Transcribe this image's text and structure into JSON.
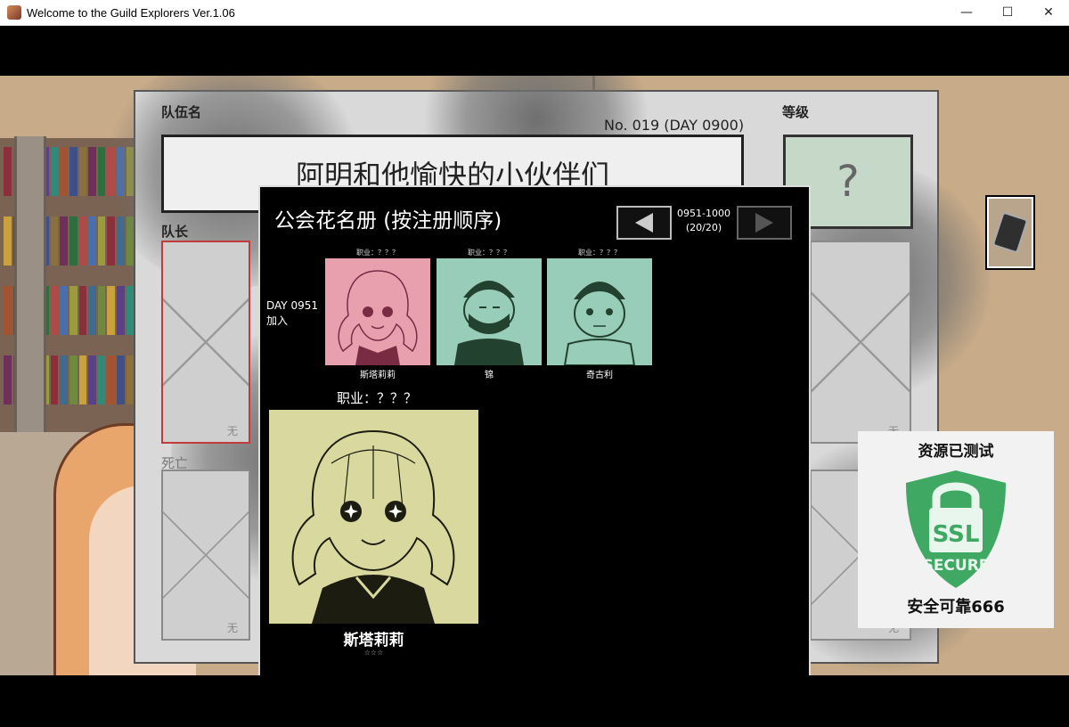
{
  "window": {
    "title": "Welcome to the Guild Explorers Ver.1.06",
    "minimize_glyph": "—",
    "maximize_glyph": "☐",
    "close_glyph": "✕"
  },
  "party_sheet": {
    "team_label": "队伍名",
    "party_name": "阿明和他愉快的小伙伴们",
    "number_text": "No. 019 (DAY 0900)",
    "rank_label": "等级",
    "rank_value": "?",
    "leader_label": "队长",
    "dead_label": "死亡",
    "empty_slot_text": "无"
  },
  "roster": {
    "title": "公会花名册 (按注册顺序)",
    "range_line1": "0951-1000",
    "range_line2": "(20/20)",
    "day_line1": "DAY 0951",
    "day_line2": "加入",
    "members": [
      {
        "job": "职业：？？？",
        "name": "斯塔莉莉",
        "bg": "#e8a0ae",
        "ink": "#7a2b44"
      },
      {
        "job": "职业：？？？",
        "name": "锦",
        "bg": "#98cdb9",
        "ink": "#23412f"
      },
      {
        "job": "职业：？？？",
        "name": "奇古利",
        "bg": "#98cdb9",
        "ink": "#23412f"
      }
    ],
    "selected": {
      "job": "职业：？？？",
      "name": "斯塔莉莉",
      "sub": "☆☆☆",
      "bg": "#d8d89f",
      "ink": "#1c1c10"
    }
  },
  "ssl_badge": {
    "top_text": "资源已测试",
    "ssl_text": "SSL",
    "secure_text": "SECURE",
    "bottom_text": "安全可靠666",
    "shield_color": "#3fa964"
  },
  "side_button": {
    "icon": "card-icon"
  }
}
